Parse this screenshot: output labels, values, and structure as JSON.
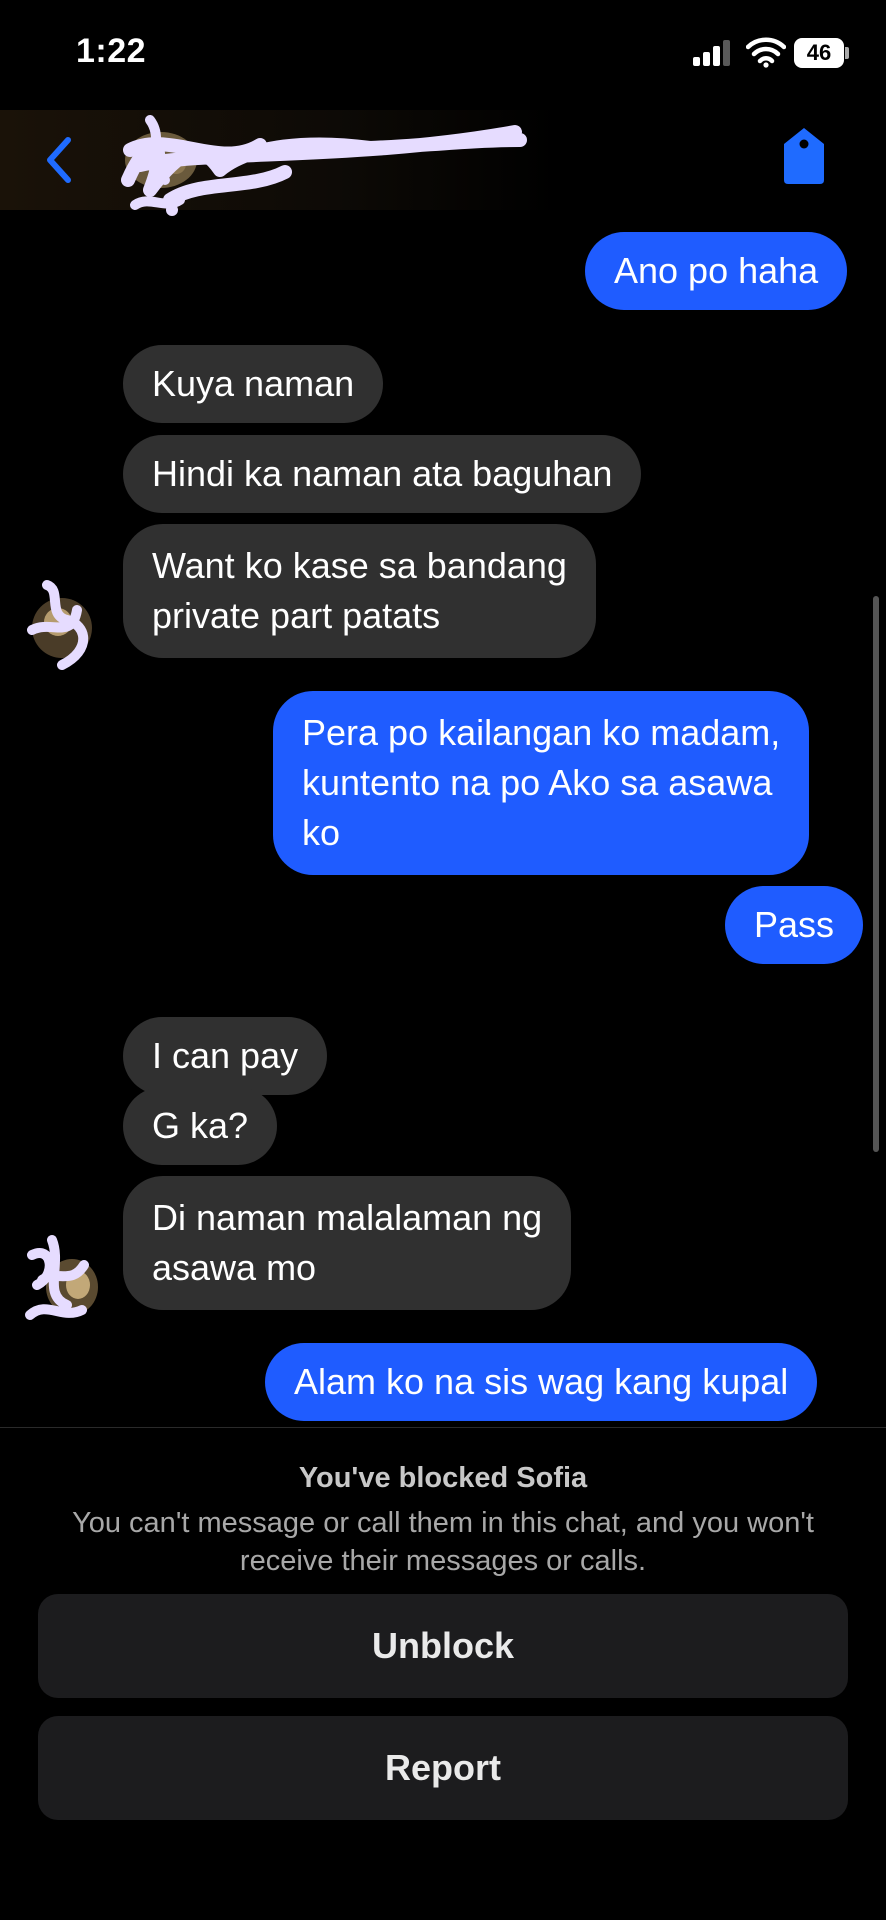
{
  "status_bar": {
    "time": "1:22",
    "battery": "46",
    "icons": [
      "signal-icon",
      "wifi-icon",
      "battery-icon"
    ]
  },
  "header": {
    "back_icon": "chevron-left-icon",
    "info_icon": "tag-icon",
    "accent_color": "#1f5cff"
  },
  "messages": [
    {
      "direction": "out",
      "lines": [
        "Ano po haha"
      ]
    },
    {
      "direction": "in",
      "lines": [
        "Kuya naman"
      ]
    },
    {
      "direction": "in",
      "lines": [
        "Hindi ka naman ata baguhan"
      ]
    },
    {
      "direction": "in",
      "lines": [
        "Want ko kase sa bandang",
        "private part patats"
      ]
    },
    {
      "direction": "out",
      "lines": [
        "Pera po kailangan ko madam,",
        "kuntento na po Ako sa asawa",
        "ko"
      ]
    },
    {
      "direction": "out",
      "lines": [
        "Pass"
      ]
    },
    {
      "direction": "in",
      "lines": [
        "I can pay"
      ]
    },
    {
      "direction": "in",
      "lines": [
        "G ka?"
      ]
    },
    {
      "direction": "in",
      "lines": [
        "Di naman malalaman ng",
        "asawa mo"
      ]
    },
    {
      "direction": "out",
      "lines": [
        "Alam ko na sis wag kang kupal"
      ]
    }
  ],
  "blocked": {
    "title": "You've blocked Sofia",
    "description": "You can't message or call them in this chat, and you won't receive their messages or calls.",
    "unblock_label": "Unblock",
    "report_label": "Report"
  },
  "colors": {
    "outgoing_bubble": "#1f5cff",
    "incoming_bubble": "#303030",
    "background": "#000000",
    "redaction_scribble": "#e6dcff"
  }
}
